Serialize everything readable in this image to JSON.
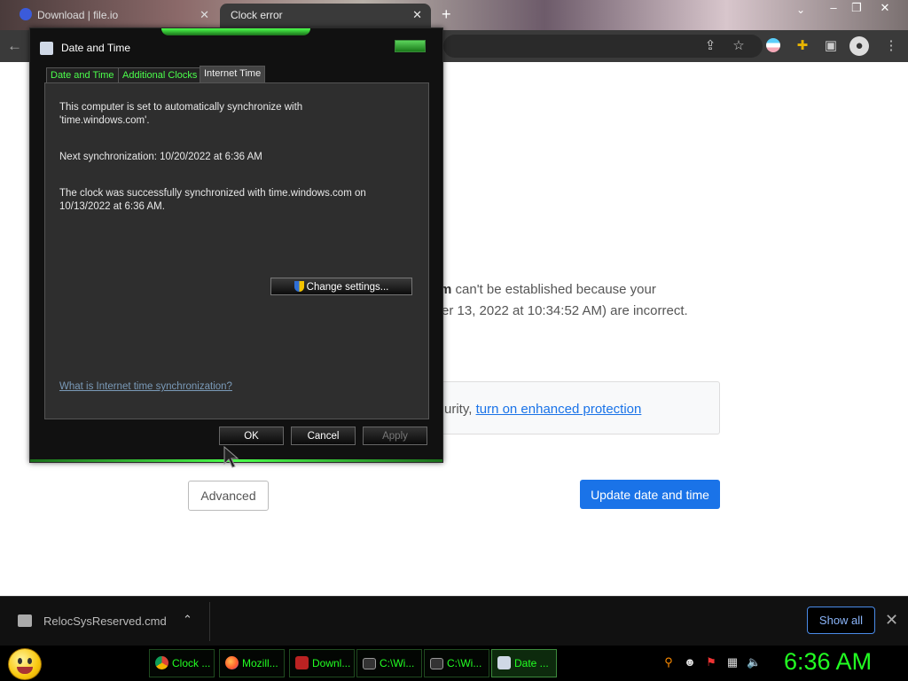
{
  "browser": {
    "tabs": [
      {
        "label": "Download | file.io"
      },
      {
        "label": "Clock error"
      }
    ],
    "new_tab": "+"
  },
  "page": {
    "error_line1_bold": "m",
    "error_line1_rest": " can't be established because your",
    "error_line2": "er 13, 2022 at 10:34:52 AM) are incorrect.",
    "enhanced_prefix": "urity, ",
    "enhanced_link": "turn on enhanced protection",
    "advanced_button": "Advanced",
    "update_button": "Update date and time"
  },
  "download_bar": {
    "file_name": "RelocSysReserved.cmd",
    "show_all": "Show all"
  },
  "dialog": {
    "title": "Date and Time",
    "tabs": [
      {
        "label": "Date and Time"
      },
      {
        "label": "Additional Clocks"
      },
      {
        "label": "Internet Time"
      }
    ],
    "sync_line1": "This computer is set to automatically synchronize with",
    "sync_line2": "'time.windows.com'.",
    "next_sync": "Next synchronization: 10/20/2022 at 6:36 AM",
    "status_line1": "The clock was successfully synchronized with time.windows.com on",
    "status_line2": "10/13/2022 at 6:36 AM.",
    "change_settings": "Change settings...",
    "help_link": "What is Internet time synchronization?",
    "ok": "OK",
    "cancel": "Cancel",
    "apply": "Apply"
  },
  "taskbar": {
    "items": [
      {
        "label": "Clock ...",
        "icon": "chrome-icon"
      },
      {
        "label": "Mozill...",
        "icon": "firefox-icon"
      },
      {
        "label": "Downl...",
        "icon": "download-icon"
      },
      {
        "label": "C:\\Wi...",
        "icon": "cmd-icon"
      },
      {
        "label": "C:\\Wi...",
        "icon": "cmd-icon"
      },
      {
        "label": "Date ...",
        "icon": "datetime-icon"
      }
    ],
    "clock": "6:36 AM"
  },
  "colors": {
    "accent_green": "#22ff22",
    "chrome_blue": "#1a73e8"
  }
}
